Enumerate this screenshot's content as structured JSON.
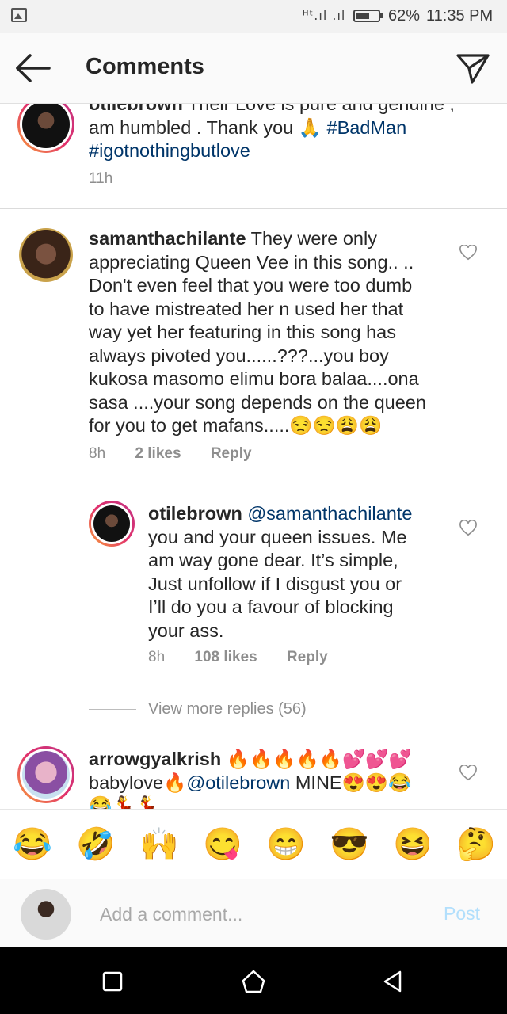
{
  "status": {
    "signal_text": "ᴴᵗ.ıl .ıl",
    "battery_percent": 62,
    "battery_label": "62%",
    "time": "11:35 PM"
  },
  "header": {
    "title": "Comments",
    "back_icon": "back-arrow-icon",
    "send_icon": "direct-send-icon"
  },
  "comments": [
    {
      "username": "otilebrown",
      "text": "Their Love is pure and genuine ,",
      "text2": "am humbled . Thank you 🙏",
      "hashtags": [
        "#BadMan",
        "#igotnothingbutlove"
      ],
      "time": "11h"
    },
    {
      "username": "samanthachilante",
      "lines": [
        "They were only",
        "appreciating Queen Vee in this song.. ..",
        "Don't even feel that you were too dumb",
        "to have mistreated her n used her that",
        "way yet her featuring in this song has",
        "always pivoted you......???...you boy",
        "kukosa masomo elimu bora balaa....ona",
        "sasa ....your song depends on the queen",
        "for you to get mafans.....😒😒😩😩"
      ],
      "time": "8h",
      "likes": "2 likes",
      "reply_label": "Reply"
    },
    {
      "username": "otilebrown",
      "mention": "@samanthachilante",
      "lines": [
        "you and your queen issues. Me",
        "am way gone dear. It’s simple,",
        "Just unfollow if  I disgust you or",
        "I’ll do you a favour of blocking",
        "your ass."
      ],
      "time": "8h",
      "likes": "108 likes",
      "reply_label": "Reply"
    },
    {
      "username": "arrowgyalkrish",
      "line1_emoji": "🔥🔥🔥🔥🔥💕💕💕",
      "line2_pre": "babylove🔥",
      "mention": "@otilebrown",
      "line2_post": " MINE😍😍😂",
      "line3": "😂💃💃"
    }
  ],
  "view_more": "View more replies (56)",
  "emojis": [
    "😂",
    "🤣",
    "🙌",
    "😋",
    "😁",
    "😎",
    "😆",
    "🤔"
  ],
  "composer": {
    "placeholder": "Add a comment...",
    "post_label": "Post"
  },
  "colors": {
    "link": "#003569",
    "meta": "#8e8e8e",
    "post_disabled": "#b2dffc"
  }
}
